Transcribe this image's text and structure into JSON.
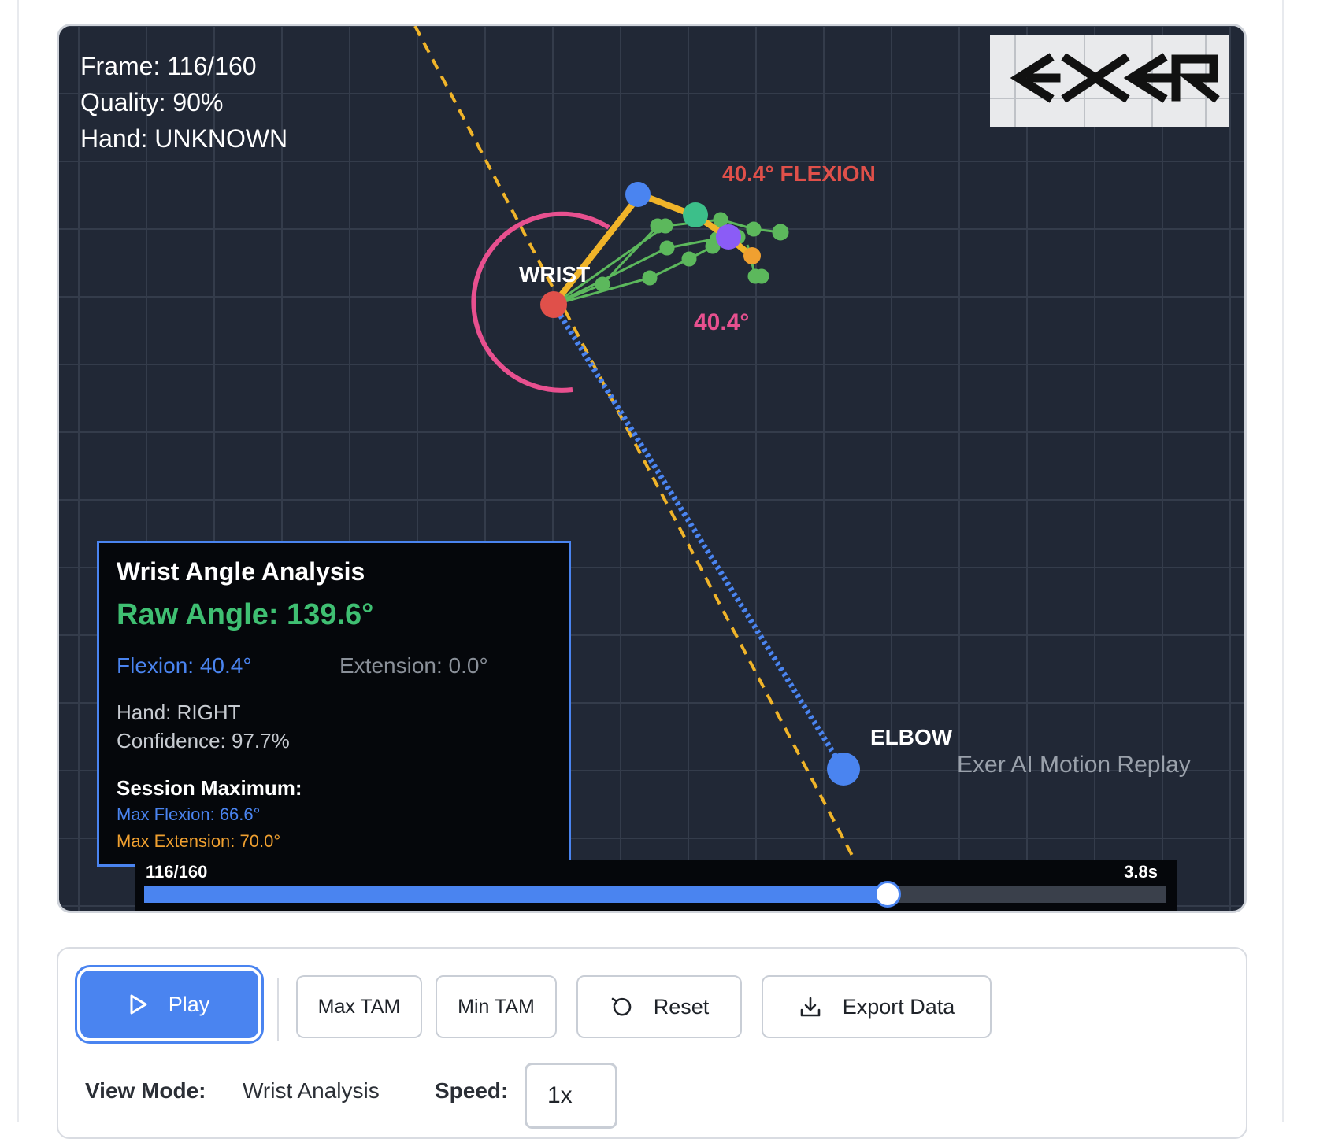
{
  "viewer": {
    "hud": {
      "frame": "Frame: 116/160",
      "quality": "Quality: 90%",
      "hand": "Hand: UNKNOWN"
    },
    "logo_text": "EXER",
    "labels": {
      "wrist": "WRIST",
      "elbow": "ELBOW",
      "flexion_callout": "40.4° FLEXION",
      "arc_angle": "40.4°",
      "replay_caption": "Exer AI Motion Replay"
    },
    "colors": {
      "background": "#212836",
      "grid": "#343c4b",
      "forearm_axis": "#f0b429",
      "forearm_line": "#4a84f0",
      "hand_bone": "#f0b429",
      "finger": "#5cb85c",
      "angle_arc": "#e8508f",
      "wrist_joint": "#e0504a",
      "elbow_joint": "#4a84f0"
    }
  },
  "analysis": {
    "title": "Wrist Angle Analysis",
    "raw_angle": "Raw Angle: 139.6°",
    "flexion": "Flexion: 40.4°",
    "extension": "Extension: 0.0°",
    "hand": "Hand: RIGHT",
    "confidence": "Confidence: 97.7%",
    "session_title": "Session Maximum:",
    "max_flexion": "Max Flexion: 66.6°",
    "max_extension": "Max Extension: 70.0°"
  },
  "timeline": {
    "frame_text": "116/160",
    "time_text": "3.8s",
    "current_frame": 116,
    "total_frames": 160
  },
  "controls": {
    "play_label": "Play",
    "max_tam_label": "Max TAM",
    "min_tam_label": "Min TAM",
    "reset_label": "Reset",
    "export_label": "Export Data",
    "view_mode_label": "View Mode:",
    "view_mode_value": "Wrist Analysis",
    "speed_label": "Speed:",
    "speed_value": "1x"
  },
  "icons": {
    "play": "play-icon",
    "reset": "reset-icon",
    "export": "download-icon"
  }
}
